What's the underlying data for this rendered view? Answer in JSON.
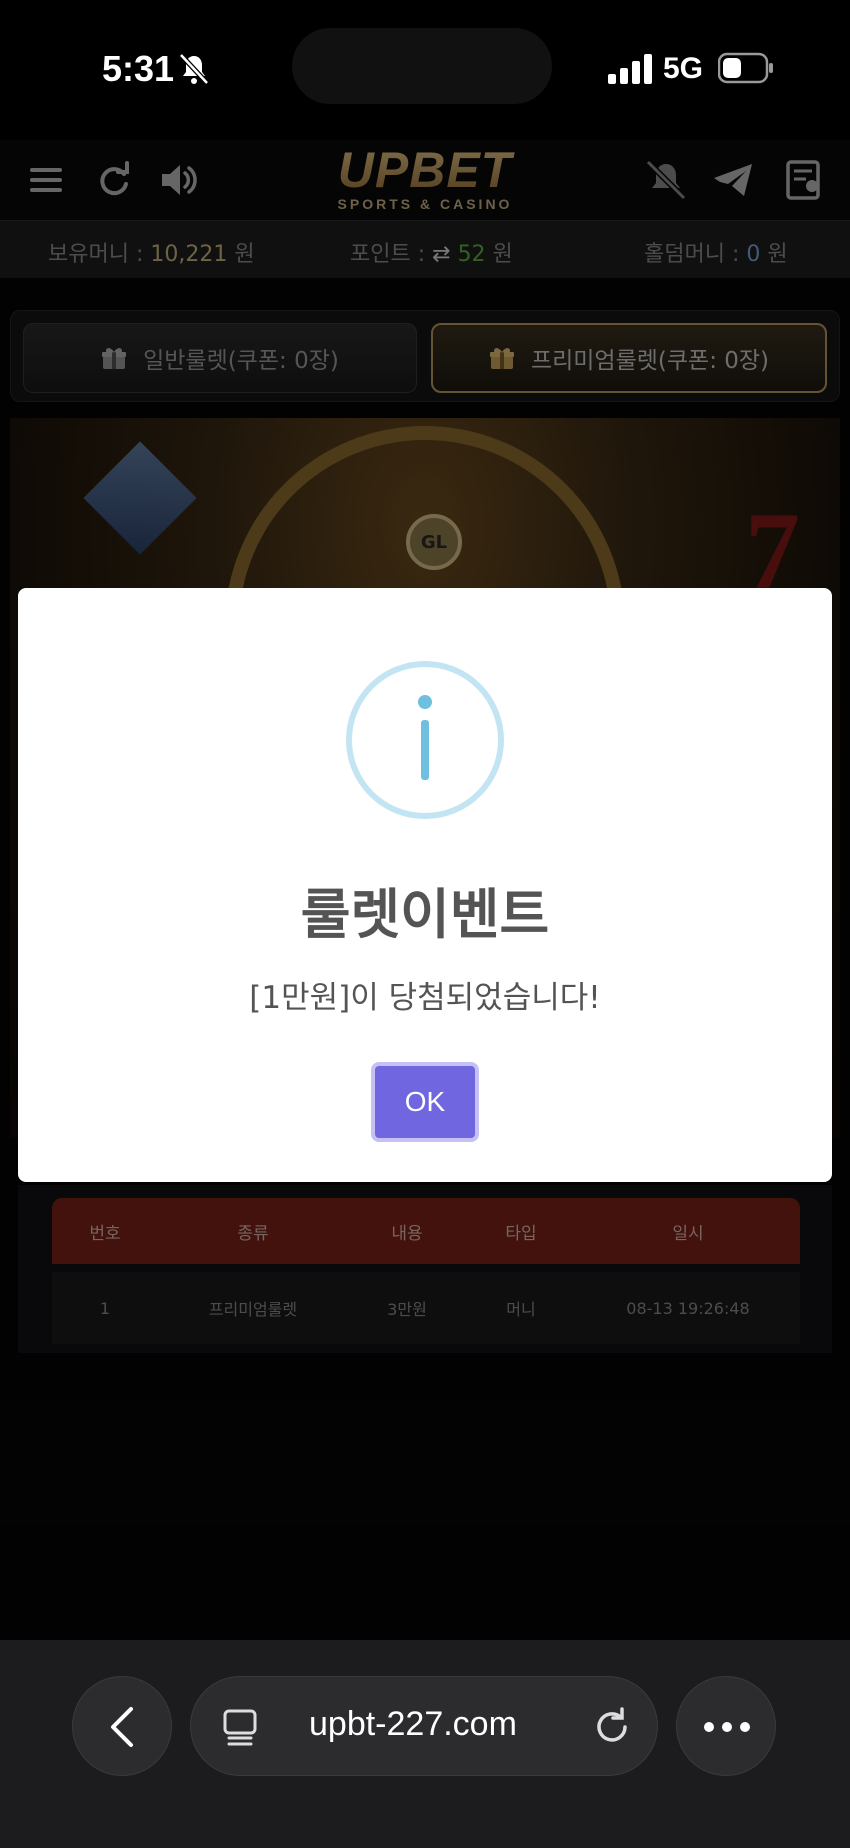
{
  "status_bar": {
    "time": "5:31",
    "network": "5G"
  },
  "header": {
    "logo_main": "UPBET",
    "logo_sub": "SPORTS & CASINO"
  },
  "balances": {
    "holding_label": "보유머니 : ",
    "holding_value": "10,221",
    "holding_unit": " 원",
    "point_label": "포인트 : ",
    "point_value": "52",
    "point_unit": " 원",
    "holdem_label": "홀덤머니 : ",
    "holdem_value": "0",
    "holdem_unit": " 원"
  },
  "roulette_tabs": [
    {
      "label": "일반룰렛(쿠폰: 0장)"
    },
    {
      "label": "프리미엄룰렛(쿠폰: 0장)"
    }
  ],
  "banner": {
    "pointer_label": "GL"
  },
  "history": {
    "columns": [
      "번호",
      "종류",
      "내용",
      "타입",
      "일시"
    ],
    "rows": [
      [
        "1",
        "프리미엄룰렛",
        "3만원",
        "머니",
        "08-13 19:26:48"
      ]
    ]
  },
  "modal": {
    "title": "룰렛이벤트",
    "message": "[1만원]이 당첨되었습니다!",
    "ok_label": "OK",
    "accent_color": "#7066e0",
    "icon_color": "#87c9e6"
  },
  "browser": {
    "url": "upbt-227.com"
  }
}
